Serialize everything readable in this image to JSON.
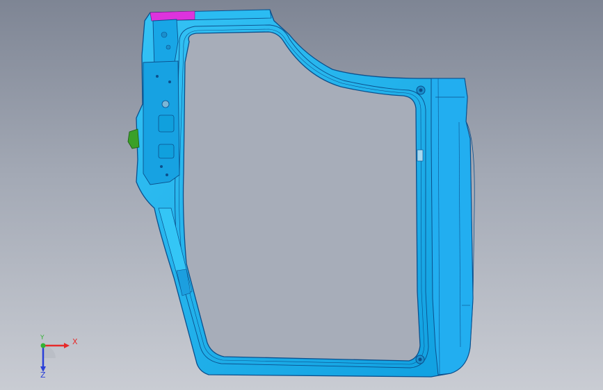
{
  "viewport": {
    "background_top": "#7e8594",
    "background_bottom": "#c9ccd3"
  },
  "model": {
    "part": "door-frame",
    "body_color": "#1fb2ee",
    "edge_color": "#0b4f8c",
    "highlight_color": "#dd33dd",
    "clip_color": "#3aa028"
  },
  "triad": {
    "x_label": "X",
    "y_label": "Y",
    "z_label": "Z",
    "x_color": "#e62a2a",
    "y_color": "#33b233",
    "z_color": "#2a3fd8"
  }
}
